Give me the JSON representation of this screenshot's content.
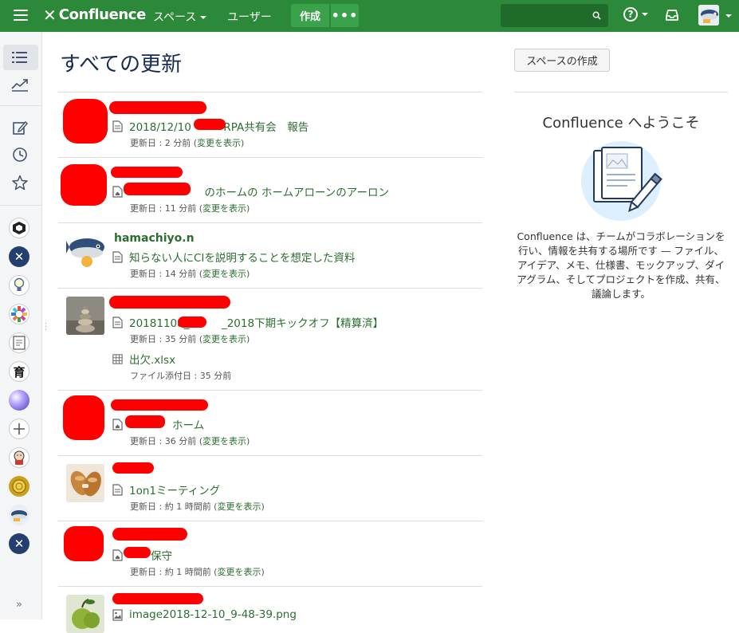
{
  "topbar": {
    "brand": "Confluence",
    "nav_spaces": "スペース",
    "nav_users": "ユーザー",
    "create_label": "作成",
    "more_label": "•••",
    "search_placeholder": "",
    "help_label": "?"
  },
  "colors": {
    "header": "#2c8939",
    "link": "#2b6e2f",
    "redaction": "#ff0000"
  },
  "main": {
    "title": "すべての更新",
    "feed": [
      {
        "author": "",
        "entries": [
          {
            "icon": "page-icon",
            "title": "2018/12/10　　　RPA共有会　報告",
            "meta_prefix": "更新日 : 2 分前 (",
            "meta_link": "変更を表示",
            "meta_suffix": ")"
          }
        ]
      },
      {
        "author": "",
        "entries": [
          {
            "icon": "home-icon",
            "title": "　　　　　　　のホームの ホームアローンのアーロン",
            "meta_prefix": "更新日 : 11 分前 (",
            "meta_link": "変更を表示",
            "meta_suffix": ")"
          }
        ]
      },
      {
        "author": "hamachiyo.n",
        "entries": [
          {
            "icon": "page-icon",
            "title": "知らない人にCIを説明することを想定した資料",
            "meta_prefix": "更新日 : 14 分前 (",
            "meta_link": "変更を表示",
            "meta_suffix": ")"
          }
        ]
      },
      {
        "author": "",
        "entries": [
          {
            "icon": "page-icon",
            "title": "20181108_　　　_2018下期キックオフ【精算済】",
            "meta_prefix": "更新日 : 35 分前 (",
            "meta_link": "変更を表示",
            "meta_suffix": ")"
          },
          {
            "icon": "spreadsheet-icon",
            "title": "出欠.xlsx",
            "meta_prefix": "ファイル添付日 : 35 分前",
            "meta_link": "",
            "meta_suffix": ""
          }
        ]
      },
      {
        "author": "",
        "entries": [
          {
            "icon": "home-icon",
            "title": "　　　　ホーム",
            "meta_prefix": "更新日 : 36 分前 (",
            "meta_link": "変更を表示",
            "meta_suffix": ")"
          }
        ]
      },
      {
        "author": "",
        "entries": [
          {
            "icon": "page-icon",
            "title": "1on1ミーティング",
            "meta_prefix": "更新日 : 約 1 時間前 (",
            "meta_link": "変更を表示",
            "meta_suffix": ")"
          }
        ]
      },
      {
        "author": "",
        "entries": [
          {
            "icon": "home-icon",
            "title": "　　保守",
            "meta_prefix": "更新日 : 約 1 時間前 (",
            "meta_link": "変更を表示",
            "meta_suffix": ")"
          }
        ]
      },
      {
        "author": "",
        "entries": [
          {
            "icon": "image-icon",
            "title": "image2018-12-10_9-48-39.png",
            "meta_prefix": "",
            "meta_link": "",
            "meta_suffix": ""
          }
        ]
      }
    ]
  },
  "right": {
    "create_space_label": "スペースの作成",
    "welcome_title": "Confluence へようこそ",
    "welcome_text": "Confluence は、チームがコラボレーションを行い、情報を共有する場所です — ファイル、アイデア、メモ、仕様書、モックアップ、ダイアグラム、そしてプロジェクトを作成、共有、議論します。"
  },
  "sidebar": {
    "expand_label": "»"
  }
}
